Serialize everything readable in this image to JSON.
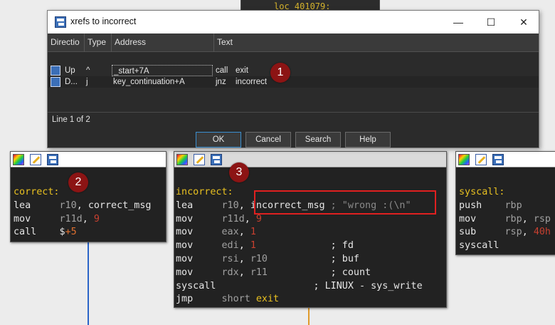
{
  "top_block": {
    "label": "loc_401079:"
  },
  "dialog": {
    "title": "xrefs to incorrect",
    "buttons": {
      "minimize": "—",
      "maximize": "☐",
      "close": "✕"
    },
    "columns": [
      "Directio",
      "Type",
      "Address",
      "Text"
    ],
    "rows": [
      {
        "direction": "Up",
        "type": "^",
        "address": "_start+7A",
        "mnemonic": "call",
        "operand": "exit"
      },
      {
        "direction": "D...",
        "type": "j",
        "address": "key_continuation+A",
        "mnemonic": "jnz",
        "operand": "incorrect"
      }
    ],
    "status": "Line 1 of 2",
    "actions": {
      "ok": "OK",
      "cancel": "Cancel",
      "search": "Search",
      "help": "Help"
    }
  },
  "badges": [
    "1",
    "2",
    "3"
  ],
  "block_correct": {
    "label": "correct:",
    "lines": [
      {
        "mnemonic": "lea",
        "reg": "r10",
        "sep": ", ",
        "operand": "correct_msg"
      },
      {
        "mnemonic": "mov",
        "reg": "r11d",
        "sep": ", ",
        "number": "9"
      },
      {
        "mnemonic": "call",
        "dollar": "$",
        "plus": "+5"
      }
    ]
  },
  "block_incorrect": {
    "label": "incorrect:",
    "lines": [
      {
        "mnemonic": "lea",
        "reg": "r10",
        "sep": ", ",
        "operand": "incorrect_msg",
        "comment": " ; \"wrong :(\\n\""
      },
      {
        "mnemonic": "mov",
        "reg": "r11d",
        "sep": ", ",
        "number": "9"
      },
      {
        "mnemonic": "mov",
        "reg": "eax",
        "sep": ", ",
        "number": "1"
      },
      {
        "mnemonic": "mov",
        "reg": "edi",
        "sep": ", ",
        "number": "1",
        "comment": "             ; fd"
      },
      {
        "mnemonic": "mov",
        "reg": "rsi",
        "sep": ", ",
        "reg2": "r10",
        "comment": "           ; buf"
      },
      {
        "mnemonic": "mov",
        "reg": "rdx",
        "sep": ", ",
        "reg2": "r11",
        "comment": "           ; count"
      },
      {
        "mnemonic": "syscall",
        "comment": "                 ; LINUX - sys_write"
      },
      {
        "mnemonic": "jmp",
        "reg": "short",
        "target": "exit"
      }
    ]
  },
  "block_right": {
    "label": "syscall:",
    "lines": [
      {
        "mnemonic": "push",
        "reg": "rbp"
      },
      {
        "mnemonic": "mov",
        "reg": "rbp",
        "sep": ", ",
        "reg2": "rsp"
      },
      {
        "mnemonic": "sub",
        "reg": "rsp",
        "sep": ", ",
        "number": "40h"
      },
      {
        "mnemonic": "syscall"
      }
    ]
  },
  "colors": {
    "label": "#e8c020",
    "number": "#c84030",
    "register": "#a0a0a0",
    "comment": "#8a8a8a",
    "highlight_box": "#e02020",
    "badge": "#8c1414"
  }
}
